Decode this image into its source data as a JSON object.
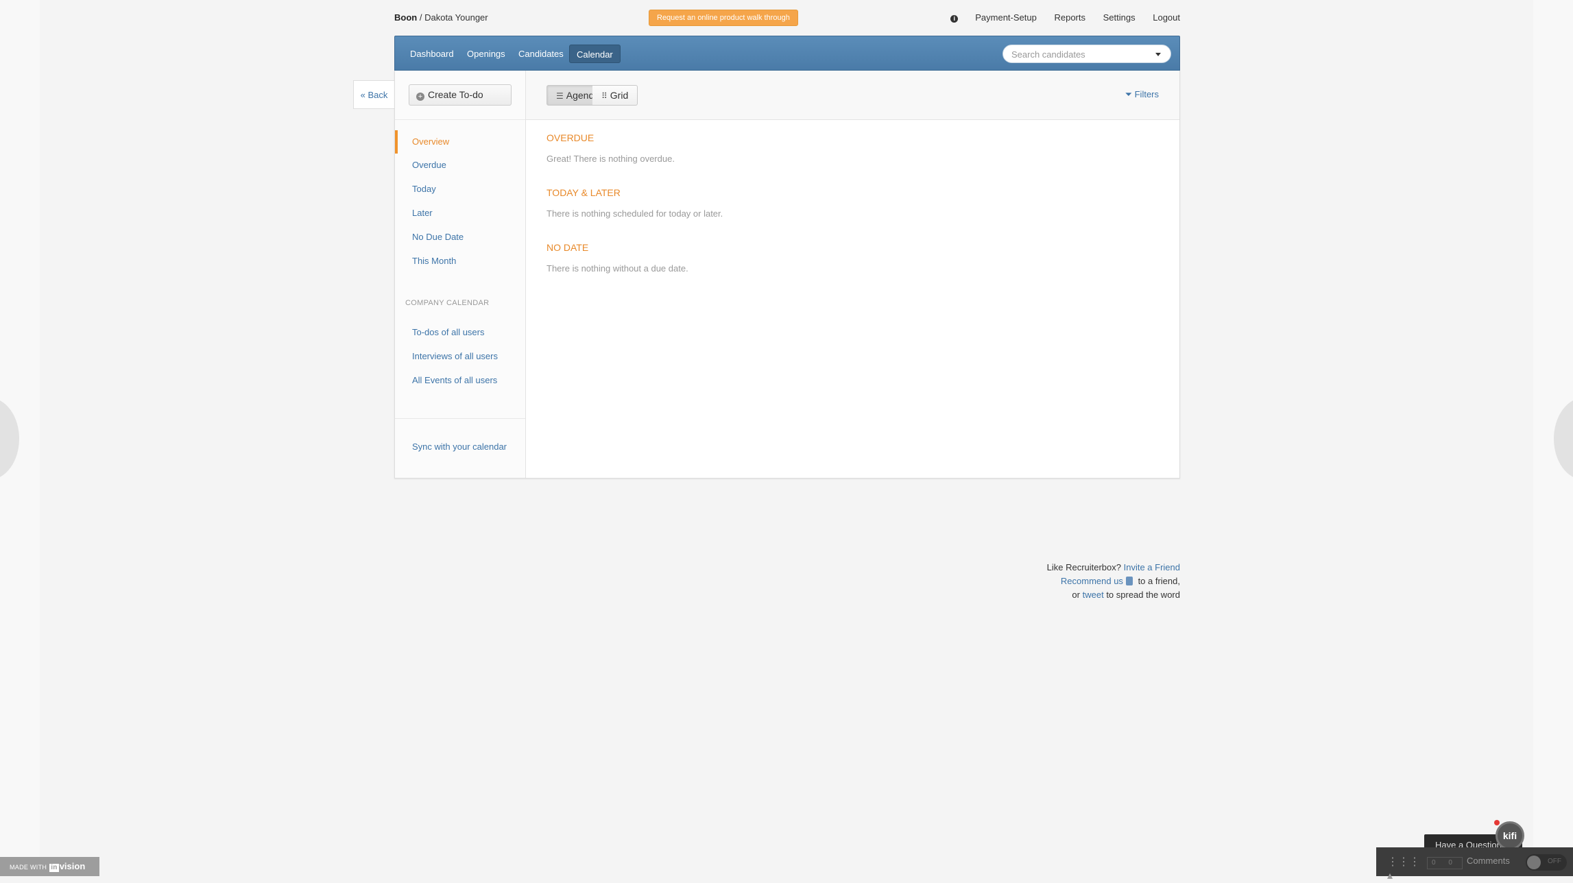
{
  "header": {
    "company": "Boon",
    "separator": "/",
    "user": "Dakota Younger",
    "promo_label": "Request an online product walk through",
    "links": [
      "Payment-Setup",
      "Reports",
      "Settings",
      "Logout"
    ]
  },
  "nav": {
    "tabs": [
      "Dashboard",
      "Openings",
      "Candidates",
      "Calendar"
    ],
    "active_tab": "Calendar",
    "search_placeholder": "Search candidates"
  },
  "back_label": "« Back",
  "sidebar": {
    "create_label": "Create To-do",
    "items": [
      "Overview",
      "Overdue",
      "Today",
      "Later",
      "No Due Date",
      "This Month"
    ],
    "active_item": "Overview",
    "company_section": "COMPANY CALENDAR",
    "company_items": [
      "To-dos of all users",
      "Interviews of all users",
      "All Events of all users"
    ],
    "sync_label": "Sync with your calendar"
  },
  "toolbar": {
    "agenda_label": "Agenda",
    "grid_label": "Grid",
    "filters_label": "Filters",
    "selected_view": "Agenda"
  },
  "sections": [
    {
      "title": "OVERDUE",
      "text": "Great! There is nothing overdue."
    },
    {
      "title": "TODAY & LATER",
      "text": "There is nothing scheduled for today or later."
    },
    {
      "title": "NO DATE",
      "text": "There is nothing without a due date."
    }
  ],
  "footer": {
    "line1_prefix": "Like Recruiterbox?",
    "line1_link": "Invite a Friend",
    "line2_link": "Recommend us",
    "line2_suffix": "to a friend,",
    "line3_prefix": "or",
    "line3_link": "tweet",
    "line3_suffix": "to spread the word"
  },
  "invision": {
    "made_with_prefix": "MADE WITH",
    "logo_text": "in",
    "brand": "vision",
    "help_text": "Have a Question?",
    "kifi_label": "kifi",
    "count_a": "0",
    "count_b": "0",
    "comments_label": "Comments",
    "toggle_state": "OFF"
  },
  "colors": {
    "accent_orange": "#e8892a",
    "nav_blue": "#4a7ba8",
    "link_blue": "#3d74a8"
  }
}
